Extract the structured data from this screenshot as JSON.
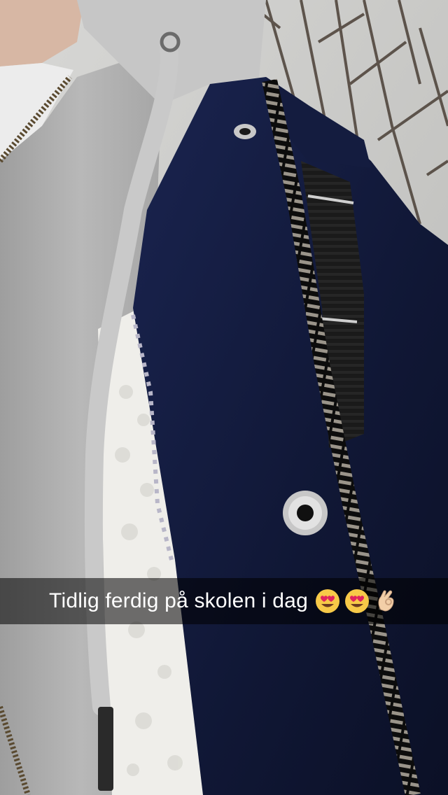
{
  "caption": {
    "text": "Tidlig ferdig på skolen i dag",
    "emojis": [
      "smiling-face-with-heart-eyes",
      "smiling-face-with-heart-eyes",
      "ok-hand"
    ]
  },
  "colors": {
    "jacket_navy": "#111a3a",
    "hoodie_gray": "#b9b9b9",
    "fleece_white": "#efefef",
    "sky": "#d9d9d9",
    "caption_bar": "rgba(0,0,0,0.55)",
    "emoji_yellow": "#f7c948",
    "heart_red": "#e0245e",
    "hand_skin": "#f3cfa8"
  }
}
